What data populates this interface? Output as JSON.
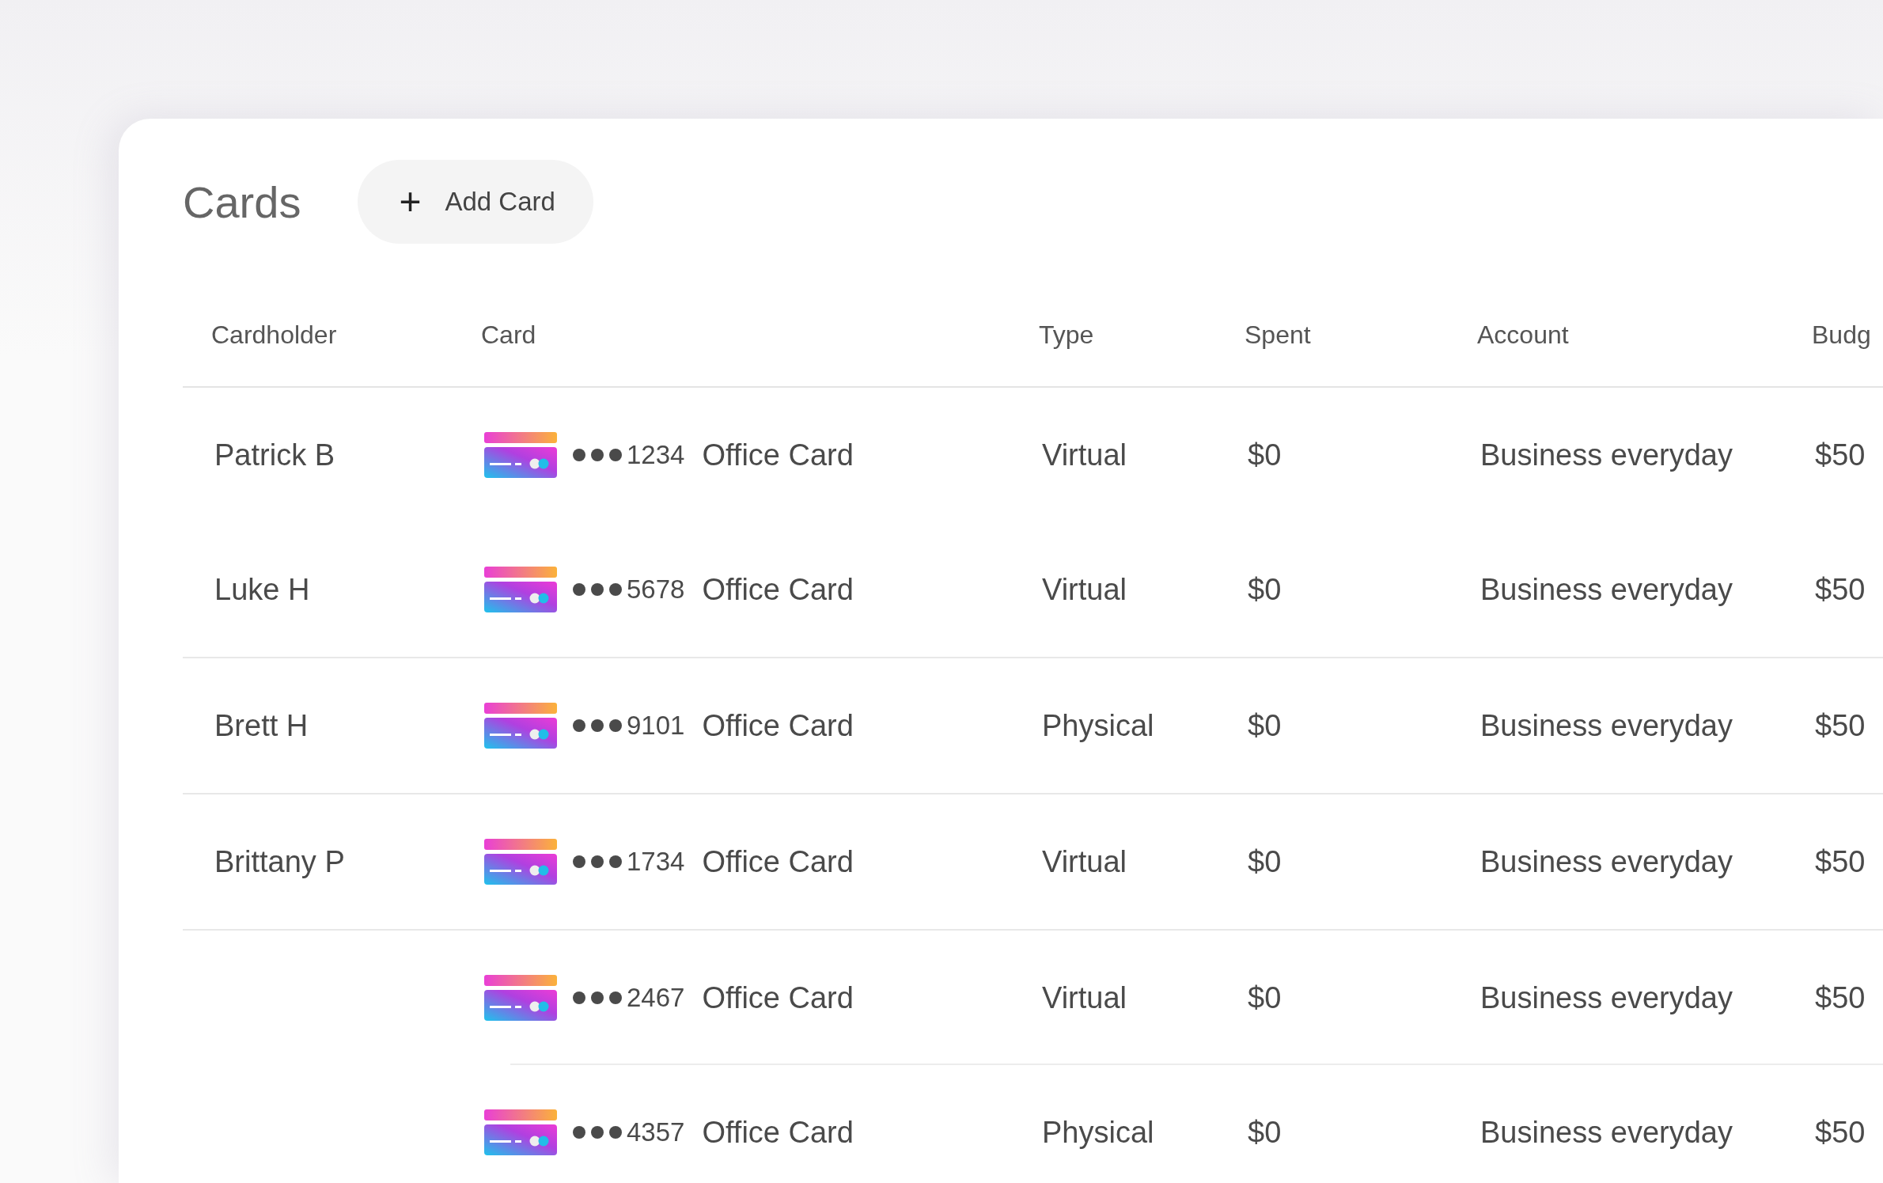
{
  "title": "Cards",
  "add_button": {
    "icon": "+",
    "label": "Add Card"
  },
  "table": {
    "columns": [
      "Cardholder",
      "Card",
      "Type",
      "Spent",
      "Account",
      "Budg"
    ],
    "rows": [
      {
        "cardholder": "Patrick B",
        "last_digits": "1234",
        "card_name": "Office Card",
        "type": "Virtual",
        "spent": "$0",
        "account": "Business everyday",
        "budget": "$50",
        "divider": false
      },
      {
        "cardholder": "Luke H",
        "last_digits": "5678",
        "card_name": "Office Card",
        "type": "Virtual",
        "spent": "$0",
        "account": "Business everyday",
        "budget": "$50",
        "divider": true,
        "divider_inset": false
      },
      {
        "cardholder": "Brett H",
        "last_digits": "9101",
        "card_name": "Office Card",
        "type": "Physical",
        "spent": "$0",
        "account": "Business everyday",
        "budget": "$50",
        "divider": true,
        "divider_inset": false
      },
      {
        "cardholder": "Brittany P",
        "last_digits": "1734",
        "card_name": "Office Card",
        "type": "Virtual",
        "spent": "$0",
        "account": "Business everyday",
        "budget": "$50",
        "divider": true,
        "divider_inset": false
      },
      {
        "last_digits": "2467",
        "card_name": "Office Card",
        "type": "Virtual",
        "spent": "$0",
        "account": "Business everyday",
        "budget": "$50",
        "divider": true,
        "divider_inset": true
      },
      {
        "last_digits": "4357",
        "card_name": "Office Card",
        "type": "Physical",
        "spent": "$0",
        "account": "Business everyday",
        "budget": "$50",
        "divider": false
      }
    ]
  }
}
